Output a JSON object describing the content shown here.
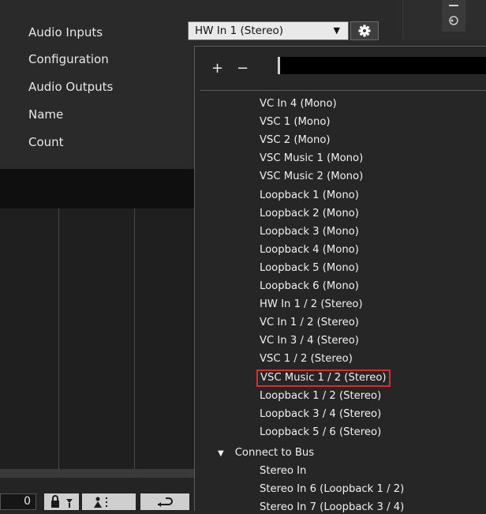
{
  "settings": {
    "labels": [
      "Audio Inputs",
      "Configuration",
      "Audio Outputs",
      "Name",
      "Count"
    ],
    "audio_inputs_value": "HW In 1 (Stereo)"
  },
  "dropdown": {
    "add_label": "+",
    "remove_label": "−",
    "items": [
      "VC In 4 (Mono)",
      "VSC 1 (Mono)",
      "VSC 2 (Mono)",
      "VSC Music 1 (Mono)",
      "VSC Music 2 (Mono)",
      "Loopback 1 (Mono)",
      "Loopback 2 (Mono)",
      "Loopback 3 (Mono)",
      "Loopback 4 (Mono)",
      "Loopback 5 (Mono)",
      "Loopback 6 (Mono)",
      "HW In 1 / 2 (Stereo)",
      "VC In 1 / 2 (Stereo)",
      "VC In 3 / 4 (Stereo)",
      "VSC 1 / 2 (Stereo)",
      "VSC Music 1 / 2 (Stereo)",
      "Loopback 1 / 2 (Stereo)",
      "Loopback 3 / 4 (Stereo)",
      "Loopback 5 / 6 (Stereo)"
    ],
    "selected_item": "VSC Music 1 / 2 (Stereo)",
    "bus_group": {
      "label": "Connect to Bus",
      "items": [
        "Stereo In",
        "Stereo In 6 (Loopback 1 / 2)",
        "Stereo In 7 (Loopback 3 / 4)"
      ]
    }
  },
  "toolbar": {
    "count_value": "0"
  },
  "colors": {
    "highlight_border": "#d32f2f"
  }
}
